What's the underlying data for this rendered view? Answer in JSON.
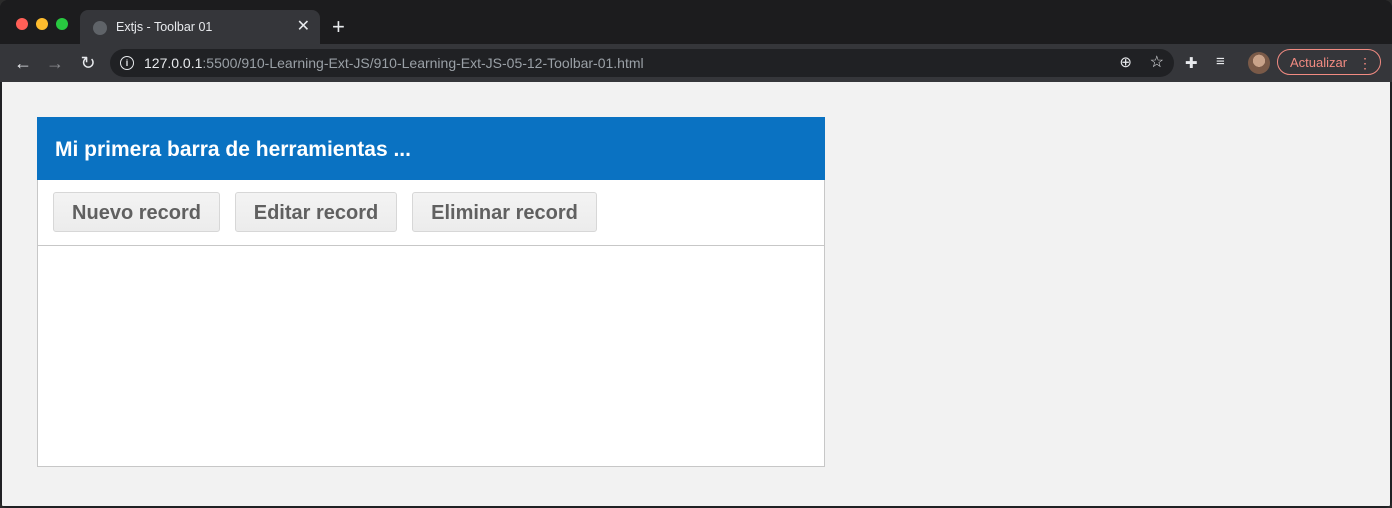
{
  "browser": {
    "tab": {
      "title": "Extjs - Toolbar 01"
    },
    "address": {
      "host": "127.0.0.1",
      "rest": ":5500/910-Learning-Ext-JS/910-Learning-Ext-JS-05-12-Toolbar-01.html"
    },
    "update_label": "Actualizar"
  },
  "panel": {
    "title": "Mi primera barra de herramientas ...",
    "buttons": [
      "Nuevo record",
      "Editar record",
      "Eliminar record"
    ]
  },
  "colors": {
    "header_blue": "#0a72c2",
    "page_bg": "#f2f2f2",
    "update_accent": "#f28b82"
  }
}
